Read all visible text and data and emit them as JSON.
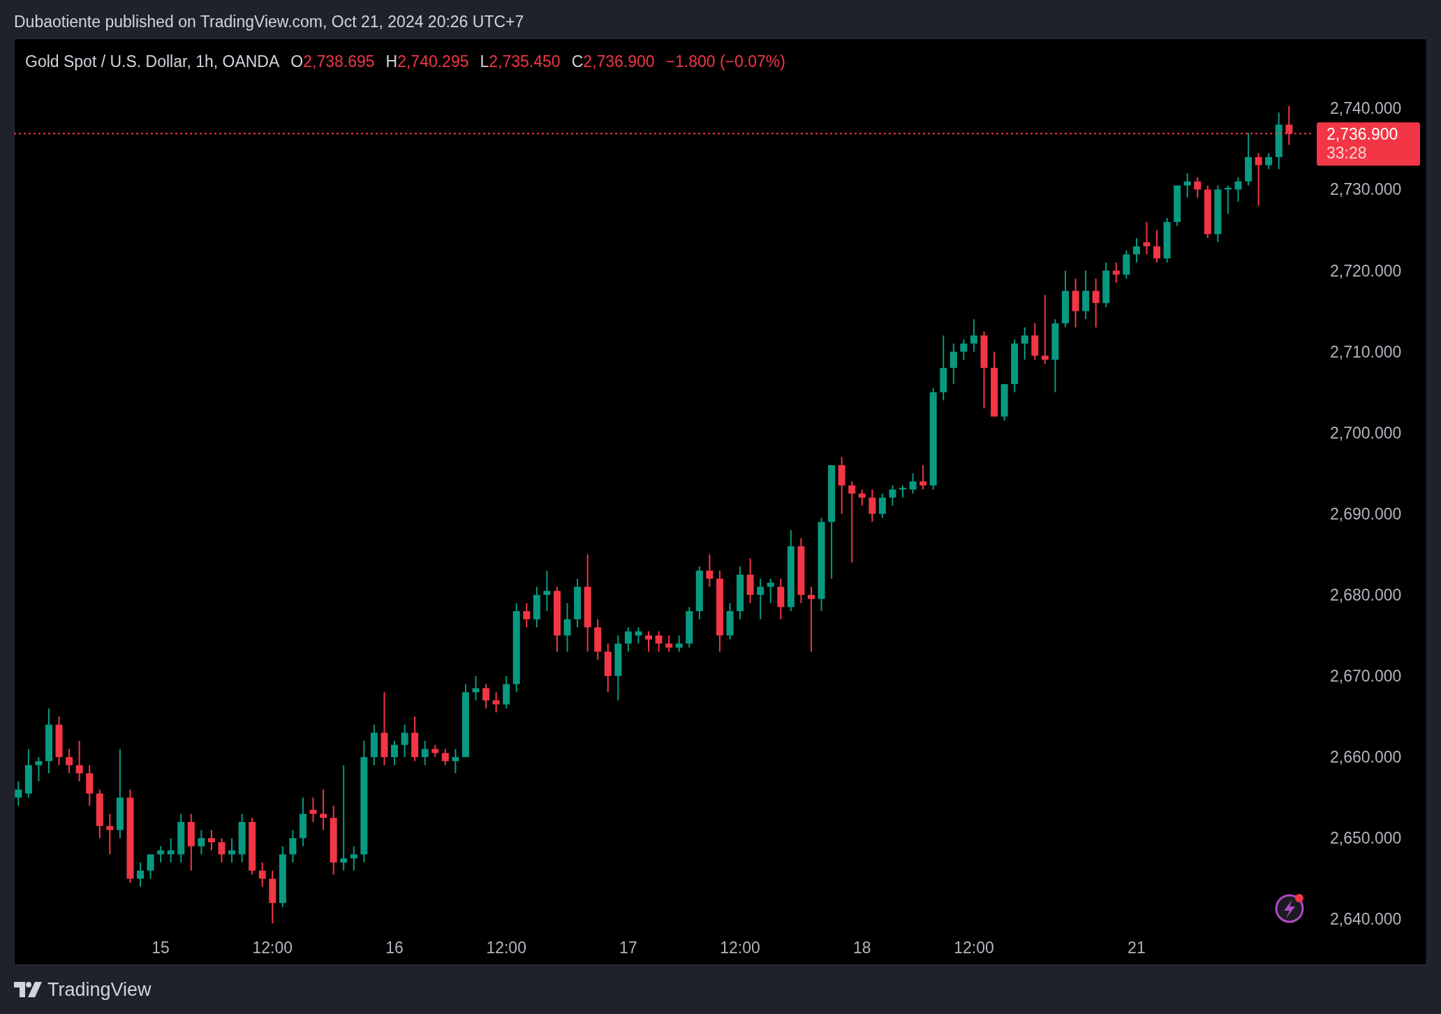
{
  "header": {
    "text": "Dubaotiente published on TradingView.com, Oct 21, 2024 20:26 UTC+7"
  },
  "legend": {
    "symbol": "Gold Spot / U.S. Dollar, 1h, OANDA",
    "fields": [
      {
        "label": "O",
        "value": "2,738.695"
      },
      {
        "label": "H",
        "value": "2,740.295"
      },
      {
        "label": "L",
        "value": "2,735.450"
      },
      {
        "label": "C",
        "value": "2,736.900"
      }
    ],
    "change": "−1.800 (−0.07%)"
  },
  "price_tag": {
    "price": "2,736.900",
    "countdown": "33:28"
  },
  "chart": {
    "chart_data": {
      "type": "candlestick",
      "ylim": [
        2640,
        2740
      ],
      "ref_lines": [
        {
          "axis": "y",
          "value": 2736.9,
          "color": "#f23645"
        }
      ],
      "categories": [
        null,
        null,
        null,
        null,
        null,
        null,
        null,
        null,
        null,
        null,
        null,
        null,
        null,
        null,
        null,
        null,
        null,
        null,
        null,
        null,
        null,
        null,
        null,
        null,
        null,
        null,
        null,
        null,
        null,
        null,
        null,
        null,
        null,
        null,
        null,
        null,
        null,
        null,
        null,
        null,
        null,
        null,
        null,
        null,
        null,
        null,
        null,
        null,
        null,
        null,
        null,
        null,
        null,
        null,
        null,
        null,
        null,
        null,
        null,
        null,
        null,
        null,
        null,
        null,
        null,
        null,
        null,
        null,
        null,
        null,
        null,
        null,
        null,
        null,
        null,
        null,
        null,
        null,
        null,
        null,
        null,
        null,
        null,
        null,
        null,
        null,
        null,
        null,
        null,
        null,
        null,
        null,
        null,
        null,
        null,
        null,
        null,
        null,
        null,
        null,
        null,
        null,
        null,
        null,
        null,
        null,
        null,
        null,
        null,
        null,
        null,
        null,
        null,
        null,
        null,
        null,
        null,
        null,
        null,
        null,
        null,
        null,
        null,
        null,
        null,
        null
      ],
      "yticks": [
        {
          "value": 2740,
          "label": "2,740.000"
        },
        {
          "value": 2730,
          "label": "2,730.000"
        },
        {
          "value": 2720,
          "label": "2,720.000"
        },
        {
          "value": 2710,
          "label": "2,710.000"
        },
        {
          "value": 2700,
          "label": "2,700.000"
        },
        {
          "value": 2690,
          "label": "2,690.000"
        },
        {
          "value": 2680,
          "label": "2,680.000"
        },
        {
          "value": 2670,
          "label": "2,670.000"
        },
        {
          "value": 2660,
          "label": "2,660.000"
        },
        {
          "value": 2650,
          "label": "2,650.000"
        },
        {
          "value": 2640,
          "label": "2,640.000"
        }
      ],
      "ohlc": [
        [
          2655,
          2657,
          2654,
          2656
        ],
        [
          2655.5,
          2661,
          2655,
          2659
        ],
        [
          2659,
          2660,
          2657,
          2659.5
        ],
        [
          2659.5,
          2666,
          2658,
          2664
        ],
        [
          2664,
          2665,
          2659,
          2660
        ],
        [
          2660,
          2661,
          2658,
          2659
        ],
        [
          2659,
          2662,
          2657,
          2658
        ],
        [
          2658,
          2659,
          2654,
          2655.5
        ],
        [
          2655.5,
          2656,
          2650,
          2651.5
        ],
        [
          2651.5,
          2653,
          2648,
          2651
        ],
        [
          2651,
          2661,
          2650,
          2655
        ],
        [
          2655,
          2656,
          2644.5,
          2645
        ],
        [
          2645,
          2647,
          2644,
          2646
        ],
        [
          2646,
          2648,
          2645,
          2648
        ],
        [
          2648,
          2649,
          2647,
          2648.5
        ],
        [
          2648,
          2650,
          2647,
          2648.5
        ],
        [
          2648,
          2653,
          2647,
          2652
        ],
        [
          2652,
          2653,
          2646,
          2649
        ],
        [
          2649,
          2651,
          2648,
          2650
        ],
        [
          2650,
          2651,
          2648.5,
          2649.5
        ],
        [
          2649.5,
          2650,
          2647,
          2648
        ],
        [
          2648,
          2650,
          2647,
          2648.5
        ],
        [
          2648,
          2653,
          2647,
          2652
        ],
        [
          2652,
          2652.5,
          2645.5,
          2646
        ],
        [
          2646,
          2647,
          2644,
          2645
        ],
        [
          2645,
          2646,
          2639.5,
          2642
        ],
        [
          2642,
          2649,
          2641.5,
          2648
        ],
        [
          2648,
          2651,
          2647,
          2650
        ],
        [
          2650,
          2655,
          2649,
          2653
        ],
        [
          2653.5,
          2655,
          2652,
          2653
        ],
        [
          2653,
          2656,
          2651,
          2652.5
        ],
        [
          2652.5,
          2654,
          2645.5,
          2647
        ],
        [
          2647,
          2659,
          2646,
          2647.5
        ],
        [
          2647.5,
          2649,
          2646,
          2648
        ],
        [
          2648,
          2662,
          2647,
          2660
        ],
        [
          2660,
          2664,
          2659,
          2663
        ],
        [
          2663,
          2668,
          2659,
          2660
        ],
        [
          2660,
          2662,
          2659,
          2661.5
        ],
        [
          2661.5,
          2664,
          2660,
          2663
        ],
        [
          2663,
          2665,
          2659.5,
          2660
        ],
        [
          2660,
          2662,
          2659,
          2661
        ],
        [
          2661,
          2661.5,
          2660,
          2660.5
        ],
        [
          2660.5,
          2661,
          2659,
          2659.5
        ],
        [
          2659.5,
          2661,
          2658,
          2660
        ],
        [
          2660,
          2669,
          2660,
          2668
        ],
        [
          2668,
          2670,
          2667,
          2668.5
        ],
        [
          2668.5,
          2669,
          2666,
          2667
        ],
        [
          2667,
          2668,
          2665.5,
          2666.5
        ],
        [
          2666.5,
          2670,
          2666,
          2669
        ],
        [
          2669,
          2679,
          2668,
          2678
        ],
        [
          2678,
          2679,
          2676,
          2677
        ],
        [
          2677,
          2681,
          2676,
          2680
        ],
        [
          2680,
          2683,
          2678,
          2680.5
        ],
        [
          2680.5,
          2681,
          2673,
          2675
        ],
        [
          2675,
          2679,
          2673,
          2677
        ],
        [
          2677,
          2682,
          2676,
          2681
        ],
        [
          2681,
          2685,
          2673,
          2676
        ],
        [
          2676,
          2677,
          2672,
          2673
        ],
        [
          2673,
          2674,
          2668,
          2670
        ],
        [
          2670,
          2675,
          2667,
          2674
        ],
        [
          2674,
          2676,
          2673,
          2675.5
        ],
        [
          2675,
          2676,
          2674,
          2675.5
        ],
        [
          2675,
          2675.5,
          2673,
          2674.5
        ],
        [
          2675,
          2675.5,
          2673,
          2674
        ],
        [
          2674,
          2675,
          2673,
          2673.5
        ],
        [
          2673.5,
          2675,
          2673,
          2674
        ],
        [
          2674,
          2678.5,
          2673.5,
          2678
        ],
        [
          2678,
          2683.5,
          2677,
          2683
        ],
        [
          2683,
          2685,
          2681,
          2682
        ],
        [
          2682,
          2683,
          2673,
          2675
        ],
        [
          2675,
          2679,
          2674.5,
          2678
        ],
        [
          2678,
          2683.5,
          2677,
          2682.5
        ],
        [
          2682.5,
          2684.5,
          2679,
          2680
        ],
        [
          2680,
          2682,
          2677,
          2681
        ],
        [
          2681,
          2682,
          2679,
          2681.5
        ],
        [
          2681,
          2682,
          2677,
          2678.5
        ],
        [
          2678.5,
          2688,
          2678,
          2686
        ],
        [
          2686,
          2687,
          2679,
          2680
        ],
        [
          2680,
          2681,
          2673,
          2679.5
        ],
        [
          2679.5,
          2689.5,
          2678,
          2689
        ],
        [
          2689,
          2696,
          2682,
          2696
        ],
        [
          2696,
          2697,
          2690,
          2693.5
        ],
        [
          2693.5,
          2694,
          2684,
          2692.5
        ],
        [
          2692.5,
          2693,
          2691,
          2692
        ],
        [
          2692,
          2693,
          2689,
          2690
        ],
        [
          2690,
          2692.5,
          2689.5,
          2692
        ],
        [
          2692,
          2693.5,
          2691,
          2693
        ],
        [
          2693,
          2693.5,
          2692,
          2693.2
        ],
        [
          2693,
          2695,
          2692.5,
          2694
        ],
        [
          2694,
          2696,
          2693,
          2693.5
        ],
        [
          2693.5,
          2705.5,
          2693,
          2705
        ],
        [
          2705,
          2712,
          2704,
          2708
        ],
        [
          2708,
          2711,
          2706,
          2710
        ],
        [
          2710,
          2711.5,
          2709,
          2711
        ],
        [
          2711,
          2714,
          2710,
          2712
        ],
        [
          2712,
          2712.5,
          2703,
          2708
        ],
        [
          2708,
          2710,
          2702,
          2702
        ],
        [
          2702,
          2706,
          2701.5,
          2706
        ],
        [
          2706,
          2711.5,
          2705,
          2711
        ],
        [
          2711,
          2713,
          2709,
          2712
        ],
        [
          2712,
          2713.5,
          2709,
          2709.5
        ],
        [
          2709.5,
          2717,
          2708.5,
          2709
        ],
        [
          2709,
          2714,
          2705,
          2713.5
        ],
        [
          2713.5,
          2720,
          2713,
          2717.5
        ],
        [
          2717.5,
          2719,
          2713,
          2715
        ],
        [
          2715,
          2720,
          2714,
          2717.5
        ],
        [
          2717.5,
          2719,
          2713,
          2716
        ],
        [
          2716,
          2721,
          2715.5,
          2720
        ],
        [
          2720,
          2721,
          2718.5,
          2719.5
        ],
        [
          2719.5,
          2722.5,
          2719,
          2722
        ],
        [
          2722,
          2724,
          2721,
          2723
        ],
        [
          2723.5,
          2726,
          2722,
          2723
        ],
        [
          2723,
          2725,
          2721,
          2721.5
        ],
        [
          2721.5,
          2726.5,
          2721,
          2726
        ],
        [
          2726,
          2730.5,
          2725.5,
          2730.5
        ],
        [
          2730.5,
          2732,
          2729,
          2731
        ],
        [
          2731,
          2731.5,
          2729,
          2730
        ],
        [
          2730,
          2730.5,
          2724,
          2724.5
        ],
        [
          2724.5,
          2730.5,
          2723.5,
          2730
        ],
        [
          2730,
          2730.5,
          2727,
          2730.2
        ],
        [
          2730,
          2731.5,
          2728.5,
          2731
        ],
        [
          2731,
          2737,
          2730.5,
          2734
        ],
        [
          2734,
          2734.5,
          2728,
          2733
        ],
        [
          2733,
          2734.5,
          2732.5,
          2734
        ],
        [
          2734,
          2739.5,
          2732.5,
          2738
        ],
        [
          2738,
          2740.3,
          2735.5,
          2736.9
        ]
      ]
    }
  },
  "time_axis": [
    "15",
    "12:00",
    "16",
    "12:00",
    "17",
    "12:00",
    "18",
    "12:00",
    "21"
  ],
  "footer": {
    "brand": "TradingView"
  }
}
